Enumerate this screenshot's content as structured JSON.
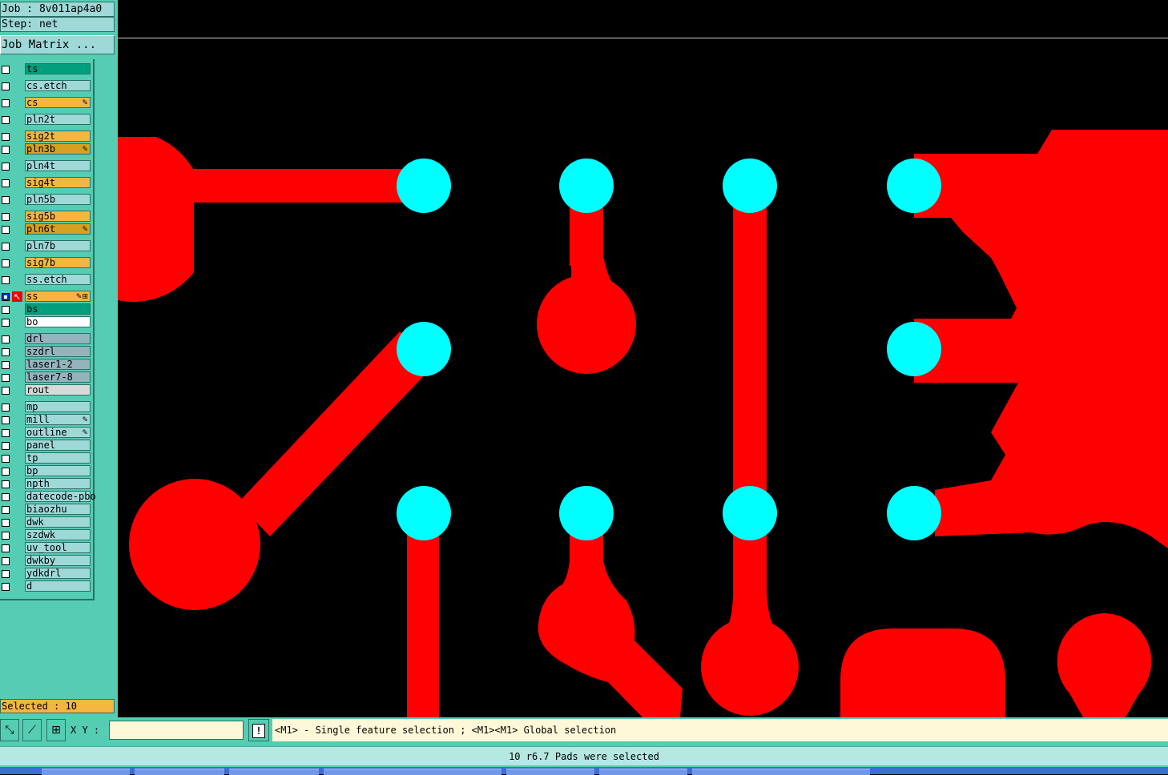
{
  "header": {
    "job": "Job : 8v011ap4a0",
    "step": "Step: net",
    "job_matrix_button": "Job Matrix ..."
  },
  "layers": [
    {
      "name": "ts",
      "color": "#00a07c",
      "mark": "",
      "active": false
    },
    {
      "name": "cs.etch",
      "color": "#9ed9d8",
      "mark": "",
      "active": false
    },
    {
      "name": "cs",
      "color": "#f5b640",
      "mark": "edit",
      "active": false
    },
    {
      "name": "pln2t",
      "color": "#9ed9d8",
      "mark": "",
      "active": false
    },
    {
      "name": "sig2t",
      "color": "#f5b640",
      "mark": "",
      "active": false
    },
    {
      "name": "pln3b",
      "color": "#d6a020",
      "mark": "edit",
      "active": false
    },
    {
      "name": "pln4t",
      "color": "#9ed9d8",
      "mark": "",
      "active": false
    },
    {
      "name": "sig4t",
      "color": "#f5b640",
      "mark": "",
      "active": false
    },
    {
      "name": "pln5b",
      "color": "#9ed9d8",
      "mark": "",
      "active": false
    },
    {
      "name": "sig5b",
      "color": "#f5b640",
      "mark": "",
      "active": false
    },
    {
      "name": "pln6t",
      "color": "#d6a020",
      "mark": "edit",
      "active": false
    },
    {
      "name": "pln7b",
      "color": "#9ed9d8",
      "mark": "",
      "active": false
    },
    {
      "name": "sig7b",
      "color": "#f5b640",
      "mark": "",
      "active": false
    },
    {
      "name": "ss.etch",
      "color": "#9ed9d8",
      "mark": "",
      "active": false
    },
    {
      "name": "ss",
      "color": "#f5b640",
      "mark": "edit-work",
      "active": true
    },
    {
      "name": "bs",
      "color": "#00a07c",
      "mark": "",
      "active": false
    },
    {
      "name": "bo",
      "color": "#ffffff",
      "mark": "",
      "active": false
    },
    {
      "name": "drl",
      "color": "#93b4bd",
      "mark": "",
      "active": false
    },
    {
      "name": "szdrl",
      "color": "#93b4bd",
      "mark": "",
      "active": false
    },
    {
      "name": "laser1-2",
      "color": "#93b4bd",
      "mark": "",
      "active": false
    },
    {
      "name": "laser7-8",
      "color": "#93b4bd",
      "mark": "",
      "active": false
    },
    {
      "name": "rout",
      "color": "#d9d9d9",
      "mark": "",
      "active": false
    },
    {
      "name": "mp",
      "color": "#9ed9d8",
      "mark": "",
      "active": false
    },
    {
      "name": "mill",
      "color": "#9ed9d8",
      "mark": "edit",
      "active": false
    },
    {
      "name": "outline",
      "color": "#9ed9d8",
      "mark": "edit",
      "active": false
    },
    {
      "name": "panel",
      "color": "#9ed9d8",
      "mark": "",
      "active": false
    },
    {
      "name": "tp",
      "color": "#9ed9d8",
      "mark": "",
      "active": false
    },
    {
      "name": "bp",
      "color": "#9ed9d8",
      "mark": "",
      "active": false
    },
    {
      "name": "npth",
      "color": "#9ed9d8",
      "mark": "",
      "active": false
    },
    {
      "name": "datecode-pbo",
      "color": "#9ed9d8",
      "mark": "",
      "active": false
    },
    {
      "name": "biaozhu",
      "color": "#9ed9d8",
      "mark": "",
      "active": false
    },
    {
      "name": "dwk",
      "color": "#9ed9d8",
      "mark": "",
      "active": false
    },
    {
      "name": "szdwk",
      "color": "#9ed9d8",
      "mark": "",
      "active": false
    },
    {
      "name": "uv_tool",
      "color": "#9ed9d8",
      "mark": "",
      "active": false
    },
    {
      "name": "dwkby",
      "color": "#9ed9d8",
      "mark": "",
      "active": false
    },
    {
      "name": "ydkdrl",
      "color": "#9ed9d8",
      "mark": "",
      "active": false
    },
    {
      "name": "d",
      "color": "#9ed9d8",
      "mark": "",
      "active": false
    }
  ],
  "selected_count": "Selected : 10",
  "toolbar": {
    "xy_label": "X Y :",
    "xy_value": "",
    "tools": [
      "select-region-icon",
      "measure-icon",
      "grid-snap-icon"
    ],
    "warn_glyph": "!"
  },
  "hint": "<M1> - Single feature selection ; <M1><M1> Global selection",
  "status": "10 r6.7 Pads were selected",
  "colors": {
    "copper": "#ff0000",
    "selected_pad": "#00ffff",
    "background": "#000000",
    "panel": "#55cdb2"
  }
}
